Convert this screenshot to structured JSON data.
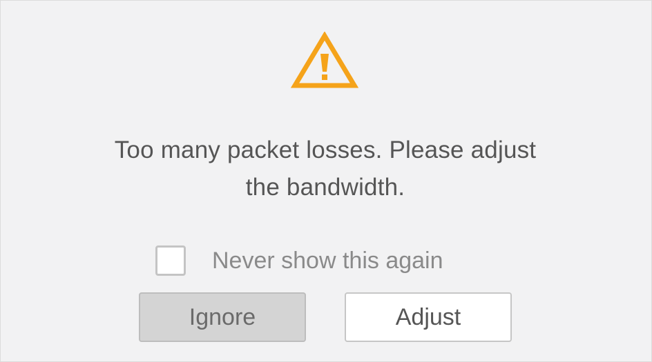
{
  "dialog": {
    "icon": "warning-icon",
    "accent_color": "#f5a31a",
    "message_line1": "Too many packet losses. Please adjust",
    "message_line2": "the bandwidth.",
    "checkbox": {
      "label": "Never show this again",
      "checked": false
    },
    "buttons": {
      "ignore_label": "Ignore",
      "adjust_label": "Adjust"
    }
  }
}
